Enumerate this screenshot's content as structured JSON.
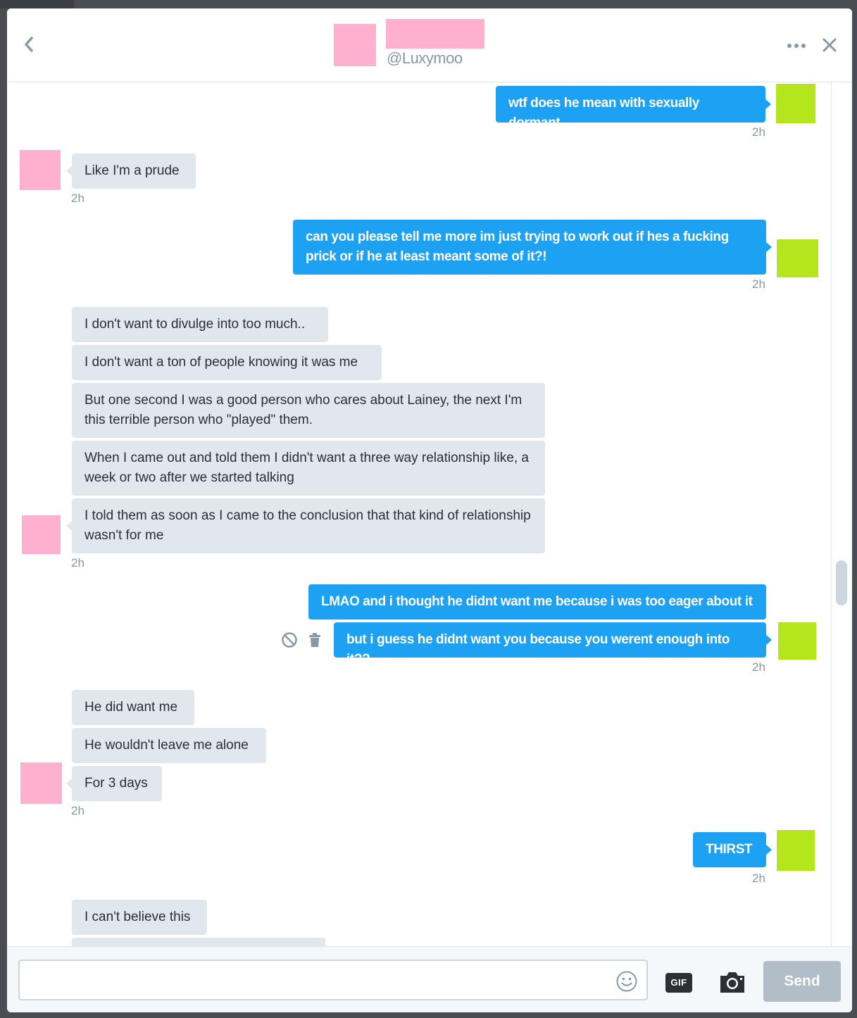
{
  "header": {
    "handle": "@Luxymoo"
  },
  "messages": {
    "m1": "wtf does he mean with sexually dormant",
    "m2": "Like I'm a prude",
    "m3": "can you please tell me more im just trying to work out if hes a fucking prick or if he at least meant some of it?!",
    "m4": "I don't want to divulge into too much..",
    "m5": "I don't want a ton of people knowing it was me",
    "m6": "But one second I was a good person who cares about Lainey, the next I'm this terrible person who \"played\" them.",
    "m7": "When I came out and told them I didn't want a three way relationship like, a week or two after we started talking",
    "m8": "I told them as soon as I came to the conclusion that that kind of relationship wasn't for me",
    "m9": "LMAO and i thought he didnt want me because i was too eager about it",
    "m10": "but i guess he didnt want you because you werent enough into it??",
    "m11": "He did want me",
    "m12": "He wouldn't leave me alone",
    "m13": "For 3 days",
    "m14": "THIRST",
    "m15": "I can't believe this"
  },
  "timestamps": {
    "t1": "2h",
    "t2": "2h",
    "t3": "2h",
    "t4": "2h",
    "t5": "2h",
    "t6": "2h",
    "t7": "2h"
  },
  "composer": {
    "placeholder": "",
    "gif_label": "GIF",
    "send_label": "Send"
  },
  "colors": {
    "outgoing_bubble": "#1da1f2",
    "incoming_bubble": "#e1e8ed",
    "avatar_other": "#ffb0cf",
    "avatar_self": "#b5e61d"
  },
  "icons": [
    "back-icon",
    "more-icon",
    "close-icon",
    "block-icon",
    "trash-icon",
    "emoji-icon",
    "gif-icon",
    "camera-icon"
  ]
}
